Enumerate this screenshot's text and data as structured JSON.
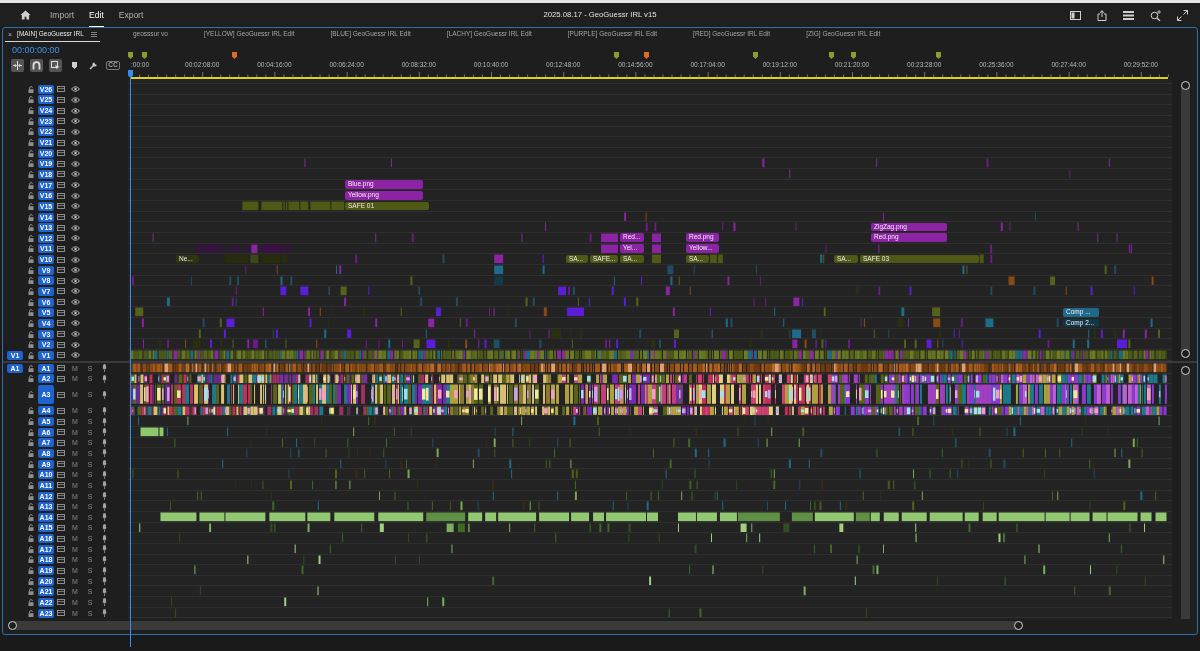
{
  "top_bar": {
    "nav": [
      {
        "label": "Import",
        "selected": false
      },
      {
        "label": "Edit",
        "selected": true
      },
      {
        "label": "Export",
        "selected": false
      }
    ],
    "title": "2025.08.17 - GeoGuessr IRL v15"
  },
  "tabs": [
    {
      "label": "[MAIN] GeoGuessr IRL",
      "close": "×",
      "selected": true
    },
    {
      "label": "geosssur vo",
      "selected": false
    },
    {
      "label": "[YELLOW] GeoGuessr IRL Edit",
      "selected": false
    },
    {
      "label": "[BLUE] GeoGuessr IRL Edit",
      "selected": false
    },
    {
      "label": "[LACHY] GeoGuessr IRL Edit",
      "selected": false
    },
    {
      "label": "[PURPLE] GeoGuessr IRL Edit",
      "selected": false
    },
    {
      "label": "[RED] GeoGuessr IRL Edit",
      "selected": false
    },
    {
      "label": "[ZIG] GeoGuessr IRL Edit",
      "selected": false
    }
  ],
  "timecode": "00:00:00:00",
  "tools": [
    {
      "kind": "nest",
      "on": true
    },
    {
      "kind": "snap",
      "on": true
    },
    {
      "kind": "linked",
      "on": true
    },
    {
      "kind": "marker",
      "on": false
    },
    {
      "kind": "settings",
      "on": false
    },
    {
      "kind": "captions",
      "label": "CC",
      "on": false
    }
  ],
  "markers": [
    {
      "color": "#8a9c2e"
    },
    {
      "color": "#8a9c2e"
    },
    {
      "color": "#e06a26"
    },
    {
      "color": "#8a9c2e"
    },
    {
      "color": "#e06a26"
    },
    {
      "color": "#8a9c2e"
    },
    {
      "color": "#8a9c2e"
    },
    {
      "color": "#8a9c2e"
    },
    {
      "color": "#8a9c2e"
    }
  ],
  "ruler": {
    "labels": [
      ":00:00",
      "00:02:08:00",
      "00:04:16:00",
      "00:06:24:00",
      "00:08:32:00",
      "00:10:40:00",
      "00:12:48:00",
      "00:14:56:00",
      "00:17:04:00",
      "00:19:12:00",
      "00:21:20:00",
      "00:23:28:00",
      "00:25:36:00",
      "00:27:44:00",
      "00:29:52:00"
    ]
  },
  "video_tracks": [
    {
      "name": "V26",
      "targeted": true
    },
    {
      "name": "V25",
      "targeted": true
    },
    {
      "name": "V24",
      "targeted": true
    },
    {
      "name": "V23",
      "targeted": true
    },
    {
      "name": "V22",
      "targeted": true
    },
    {
      "name": "V21",
      "targeted": true
    },
    {
      "name": "V20",
      "targeted": true
    },
    {
      "name": "V19",
      "targeted": true
    },
    {
      "name": "V18",
      "targeted": true
    },
    {
      "name": "V17",
      "targeted": true,
      "clips": [
        {
          "label": "Blue.png",
          "color": "#8b23a4"
        }
      ]
    },
    {
      "name": "V16",
      "targeted": true,
      "clips": [
        {
          "label": "Yellow.png",
          "color": "#8b23a4"
        }
      ]
    },
    {
      "name": "V15",
      "targeted": true,
      "clips": [
        {
          "label": "SAFE 01",
          "color": "#4f5814"
        }
      ]
    },
    {
      "name": "V14",
      "targeted": true
    },
    {
      "name": "V13",
      "targeted": true,
      "clips": [
        {
          "label": "ZigZag.png",
          "color": "#8b23a4"
        }
      ]
    },
    {
      "name": "V12",
      "targeted": true,
      "clips": [
        {
          "label": "Red...",
          "color": "#8b23a4"
        },
        {
          "label": "Red.png",
          "color": "#8b23a4"
        },
        {
          "label": "Red.png",
          "color": "#8b23a4"
        }
      ]
    },
    {
      "name": "V11",
      "targeted": true,
      "clips": [
        {
          "label": "Yel...",
          "color": "#8b23a4"
        },
        {
          "label": "Yellow...",
          "color": "#8b23a4"
        }
      ]
    },
    {
      "name": "V10",
      "targeted": true,
      "clips": [
        {
          "label": "Ne...",
          "color": "#2d3410"
        },
        {
          "label": "SA...",
          "color": "#4f5814"
        },
        {
          "label": "SAFE...",
          "color": "#4f5814"
        },
        {
          "label": "SA...",
          "color": "#4f5814"
        },
        {
          "label": "SA...",
          "color": "#4f5814"
        },
        {
          "label": "SA...",
          "color": "#4f5814"
        },
        {
          "label": "SAFE 03",
          "color": "#4f5814"
        }
      ]
    },
    {
      "name": "V9",
      "targeted": true
    },
    {
      "name": "V8",
      "targeted": true
    },
    {
      "name": "V7",
      "targeted": true
    },
    {
      "name": "V6",
      "targeted": true
    },
    {
      "name": "V5",
      "targeted": true,
      "clips": [
        {
          "label": "Comp ...",
          "color": "#1f6a88"
        }
      ]
    },
    {
      "name": "V4",
      "targeted": true,
      "clips": [
        {
          "label": "Comp 2...",
          "color": "#123847"
        }
      ]
    },
    {
      "name": "V3",
      "targeted": true
    },
    {
      "name": "V2",
      "targeted": true
    },
    {
      "name": "V1",
      "targeted": true,
      "source": "V1"
    }
  ],
  "audio_tracks": [
    {
      "name": "A1",
      "targeted": true,
      "expanded": false,
      "source": "A1",
      "mute": "M",
      "solo": "S"
    },
    {
      "name": "A2",
      "targeted": true,
      "expanded": false,
      "mute": "M",
      "solo": "S"
    },
    {
      "name": "A3",
      "targeted": true,
      "expanded": true,
      "mute": "M",
      "solo": "S"
    },
    {
      "name": "A4",
      "targeted": true,
      "expanded": false,
      "mute": "M",
      "solo": "S"
    },
    {
      "name": "A5",
      "targeted": true,
      "expanded": false,
      "mute": "M",
      "solo": "S"
    },
    {
      "name": "A6",
      "targeted": true,
      "expanded": false,
      "mute": "M",
      "solo": "S"
    },
    {
      "name": "A7",
      "targeted": true,
      "expanded": false,
      "mute": "M",
      "solo": "S"
    },
    {
      "name": "A8",
      "targeted": true,
      "expanded": false,
      "mute": "M",
      "solo": "S"
    },
    {
      "name": "A9",
      "targeted": true,
      "expanded": false,
      "mute": "M",
      "solo": "S"
    },
    {
      "name": "A10",
      "targeted": true,
      "expanded": false,
      "mute": "M",
      "solo": "S"
    },
    {
      "name": "A11",
      "targeted": true,
      "expanded": false,
      "mute": "M",
      "solo": "S"
    },
    {
      "name": "A12",
      "targeted": true,
      "expanded": false,
      "mute": "M",
      "solo": "S"
    },
    {
      "name": "A13",
      "targeted": true,
      "expanded": false,
      "mute": "M",
      "solo": "S"
    },
    {
      "name": "A14",
      "targeted": true,
      "expanded": false,
      "mute": "M",
      "solo": "S"
    },
    {
      "name": "A15",
      "targeted": true,
      "expanded": false,
      "mute": "M",
      "solo": "S"
    },
    {
      "name": "A16",
      "targeted": true,
      "expanded": false,
      "mute": "M",
      "solo": "S"
    },
    {
      "name": "A17",
      "targeted": true,
      "expanded": false,
      "mute": "M",
      "solo": "S"
    },
    {
      "name": "A18",
      "targeted": true,
      "expanded": false,
      "mute": "M",
      "solo": "S"
    },
    {
      "name": "A19",
      "targeted": true,
      "expanded": false,
      "mute": "M",
      "solo": "S"
    },
    {
      "name": "A20",
      "targeted": true,
      "expanded": false,
      "mute": "M",
      "solo": "S"
    },
    {
      "name": "A21",
      "targeted": true,
      "expanded": false,
      "mute": "M",
      "solo": "S"
    },
    {
      "name": "A22",
      "targeted": true,
      "expanded": false,
      "mute": "M",
      "solo": "S"
    },
    {
      "name": "A23",
      "targeted": true,
      "expanded": false,
      "mute": "M",
      "solo": "S"
    }
  ]
}
